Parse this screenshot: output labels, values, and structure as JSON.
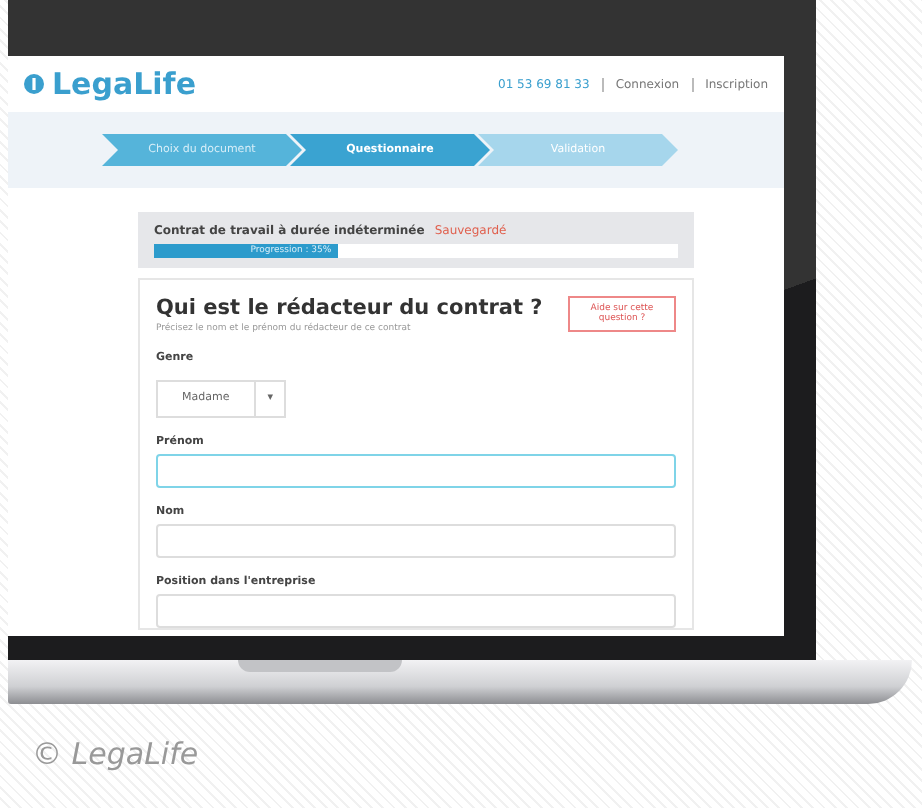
{
  "header": {
    "logo": "LegaLife",
    "phone": "01 53 69 81 33",
    "links": [
      "Connexion",
      "Inscription"
    ]
  },
  "steps": [
    {
      "label": "Choix du document",
      "selected": false,
      "completed": true
    },
    {
      "label": "Questionnaire",
      "selected": true,
      "completed": false
    },
    {
      "label": "Validation",
      "selected": false,
      "completed": false
    }
  ],
  "document": {
    "title": "Contrat de travail à durée indéterminée",
    "saved": "Sauvegardé",
    "progress": {
      "label": "Progression : 35%",
      "level": 0.35
    }
  },
  "question": {
    "title": "Qui est le rédacteur du contrat ?",
    "subtitle": "Précisez le nom et le prénom du rédacteur de ce contrat",
    "help": "Aide sur cette question ?",
    "fields": [
      {
        "kind": "select",
        "label": "Genre",
        "value": "Madame",
        "caret": "▾"
      },
      {
        "kind": "text",
        "label": "Prénom",
        "focused": true
      },
      {
        "kind": "text",
        "label": "Nom",
        "focused": false
      },
      {
        "kind": "text",
        "label": "Position dans l'entreprise",
        "focused": false
      }
    ]
  },
  "caption": "© LegaLife"
}
